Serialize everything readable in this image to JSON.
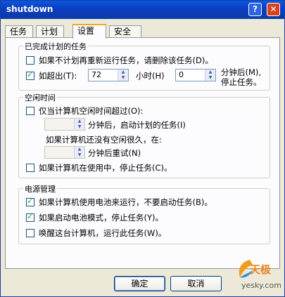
{
  "window": {
    "title": "shutdown",
    "help_glyph": "?",
    "close_glyph": "✕"
  },
  "tabs": [
    "任务",
    "计划",
    "设置",
    "安全"
  ],
  "completed": {
    "heading": "已完成计划的任务",
    "delete_not_scheduled": {
      "label": "如果不计划再重新运行任务，请删除该任务(D)。",
      "checked": false
    },
    "stop_if_exceeds": {
      "label": "如超出(T):",
      "checked": true
    },
    "hours_value": "72",
    "hours_unit": "小时(H)",
    "minutes_value": "0",
    "minutes_after_line1": "分钟后(M),",
    "minutes_after_line2": "停止任务。"
  },
  "idle": {
    "heading": "空闲时间",
    "only_if_idle": {
      "label": "仅当计算机空闲时间超过(O):",
      "checked": false
    },
    "start_after": "分钟后，启动计划的任务(I)",
    "not_idle_long": "如果计算机还没有空闲很久，在:",
    "retry_after": "分钟后重试(N)",
    "stop_if_in_use": {
      "label": "如果计算机在使用中，停止任务(C)。",
      "checked": false
    }
  },
  "power": {
    "heading": "电源管理",
    "no_start_on_battery": {
      "label": "如果计算机使用电池来运行，不要启动任务(B)。",
      "checked": true
    },
    "stop_on_battery": {
      "label": "如果启动电池模式，停止任务(Y)。",
      "checked": true
    },
    "wake_to_run": {
      "label": "唤醒这台计算机，运行此任务(W)。",
      "checked": false
    }
  },
  "buttons": {
    "ok": "确定",
    "cancel": "取消"
  },
  "watermark": {
    "brand": "天极",
    "site": "yesky.com"
  }
}
